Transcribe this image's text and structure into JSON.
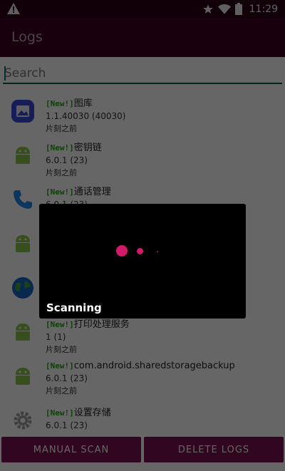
{
  "status_bar": {
    "time": "11:29"
  },
  "app_bar": {
    "title": "Logs"
  },
  "search": {
    "placeholder": "Search"
  },
  "new_tag": "[New!]",
  "apps": [
    {
      "name": "图库",
      "version": "1.1.40030 (40030)",
      "time": "片刻之前",
      "icon": "gallery-icon"
    },
    {
      "name": "密钥链",
      "version": "6.0.1 (23)",
      "time": "片刻之前",
      "icon": "android-icon"
    },
    {
      "name": "通话管理",
      "version": "6.0.1 (23)",
      "time": "",
      "icon": "phone-icon"
    },
    {
      "name": "",
      "version": "",
      "time": "",
      "icon": "android-icon"
    },
    {
      "name": "",
      "version": "",
      "time": "",
      "icon": "globe-icon"
    },
    {
      "name": "打印处理服务",
      "version": "1 (1)",
      "time": "片刻之前",
      "icon": "android-icon"
    },
    {
      "name": "com.android.sharedstoragebackup",
      "version": "6.0.1 (23)",
      "time": "片刻之前",
      "icon": "android-icon"
    },
    {
      "name": "设置存储",
      "version": "6.0.1 (23)",
      "time": "",
      "icon": "gear-icon"
    }
  ],
  "buttons": {
    "manual_scan": "MANUAL SCAN",
    "delete_logs": "DELETE LOGS"
  },
  "dialog": {
    "message": "Scanning"
  },
  "colors": {
    "primary_dark": "#2e0018",
    "primary": "#3d0021",
    "accent": "#d4186a",
    "button": "#7a1050",
    "new_tag": "#1fa80a"
  }
}
